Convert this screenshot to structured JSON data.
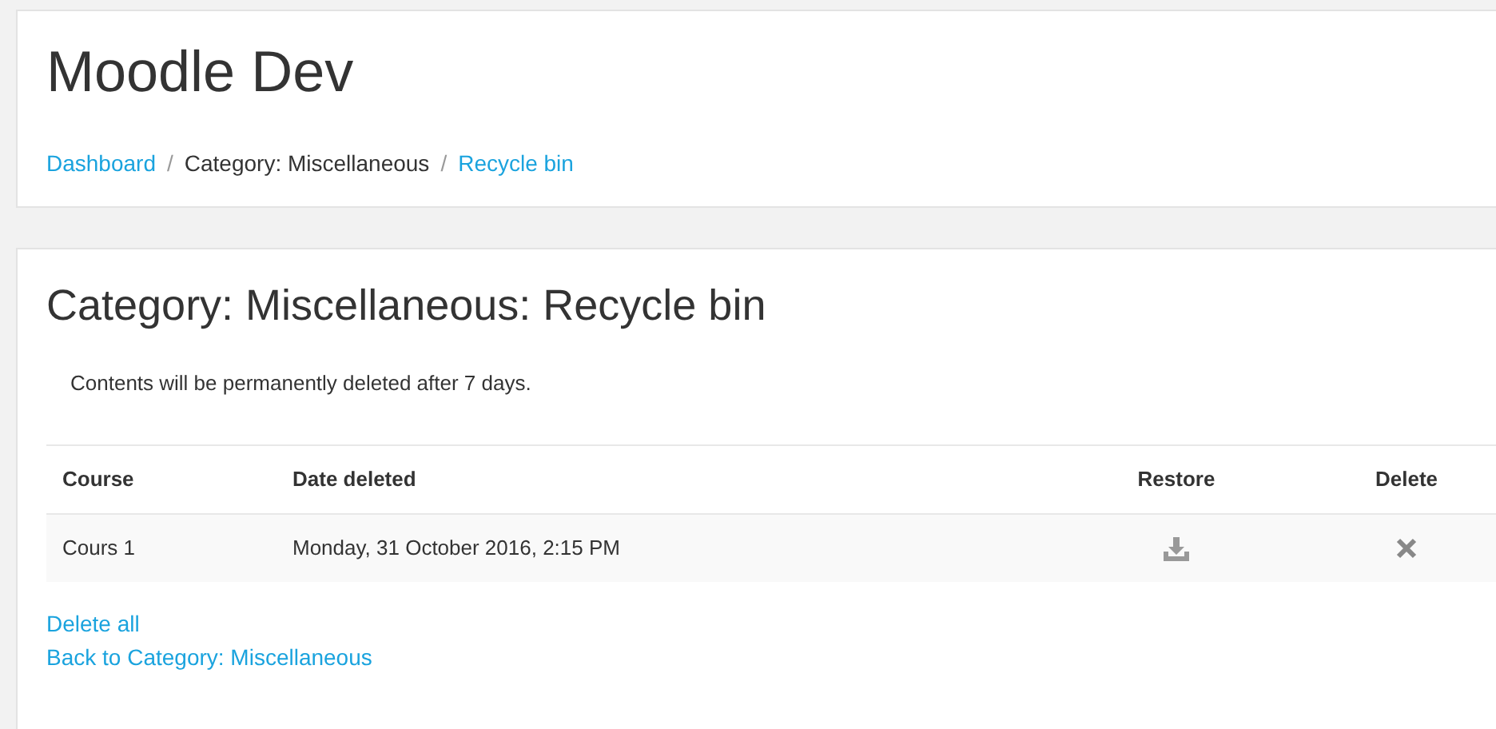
{
  "header": {
    "title": "Moodle Dev",
    "separator": "/",
    "breadcrumb": [
      {
        "label": "Dashboard",
        "link": true
      },
      {
        "label": "Category: Miscellaneous",
        "link": false
      },
      {
        "label": "Recycle bin",
        "link": true
      }
    ]
  },
  "main": {
    "title": "Category: Miscellaneous: Recycle bin",
    "notice": "Contents will be permanently deleted after 7 days.",
    "table": {
      "columns": [
        "Course",
        "Date deleted",
        "Restore",
        "Delete"
      ],
      "rows": [
        {
          "course": "Cours 1",
          "date_deleted": "Monday, 31 October 2016, 2:15 PM"
        }
      ]
    },
    "links": [
      "Delete all",
      "Back to Category: Miscellaneous"
    ]
  }
}
